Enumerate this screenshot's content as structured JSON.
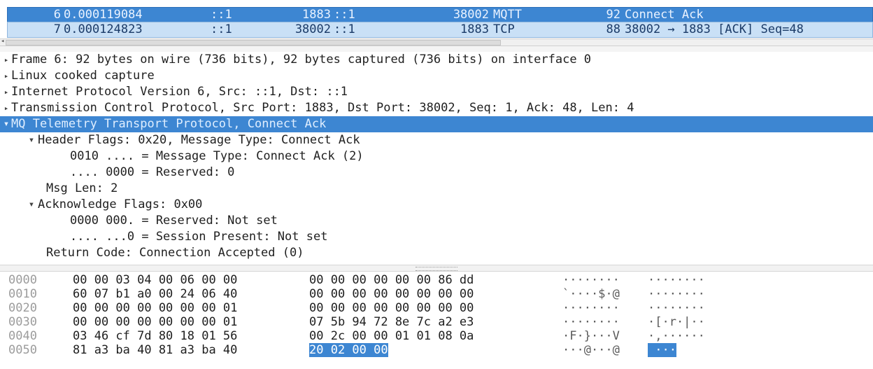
{
  "packet_list": {
    "rows": [
      {
        "no": "6",
        "time": "0.000119084",
        "src": "::1",
        "src_port": "1883",
        "dst": "::1",
        "dst_port": "38002",
        "protocol": "MQTT",
        "length": "92",
        "info": "Connect Ack",
        "selected": true
      },
      {
        "no": "7",
        "time": "0.000124823",
        "src": "::1",
        "src_port": "38002",
        "dst": "::1",
        "dst_port": "1883",
        "protocol": "TCP",
        "length": "88",
        "info": "38002 → 1883 [ACK] Seq=48",
        "selected": false
      }
    ]
  },
  "details": {
    "rows": [
      {
        "text": "Frame 6: 92 bytes on wire (736 bits), 92 bytes captured (736 bits) on interface 0",
        "indent": 0,
        "toggle": "collapsed",
        "selected": false
      },
      {
        "text": "Linux cooked capture",
        "indent": 0,
        "toggle": "collapsed",
        "selected": false
      },
      {
        "text": "Internet Protocol Version 6, Src: ::1, Dst: ::1",
        "indent": 0,
        "toggle": "collapsed",
        "selected": false
      },
      {
        "text": "Transmission Control Protocol, Src Port: 1883, Dst Port: 38002, Seq: 1, Ack: 48, Len: 4",
        "indent": 0,
        "toggle": "collapsed",
        "selected": false
      },
      {
        "text": "MQ Telemetry Transport Protocol, Connect Ack",
        "indent": 0,
        "toggle": "expanded",
        "selected": true
      },
      {
        "text": "Header Flags: 0x20, Message Type: Connect Ack",
        "indent": 1,
        "toggle": "expanded",
        "selected": false
      },
      {
        "text": "0010 .... = Message Type: Connect Ack (2)",
        "indent": 2,
        "toggle": "none",
        "selected": false
      },
      {
        "text": ".... 0000 = Reserved: 0",
        "indent": 2,
        "toggle": "none",
        "selected": false
      },
      {
        "text": "Msg Len: 2",
        "indent": 1,
        "toggle": "none",
        "selected": false
      },
      {
        "text": "Acknowledge Flags: 0x00",
        "indent": 1,
        "toggle": "expanded",
        "selected": false
      },
      {
        "text": "0000 000. = Reserved: Not set",
        "indent": 2,
        "toggle": "none",
        "selected": false
      },
      {
        "text": ".... ...0 = Session Present: Not set",
        "indent": 2,
        "toggle": "none",
        "selected": false
      },
      {
        "text": "Return Code: Connection Accepted (0)",
        "indent": 1,
        "toggle": "none",
        "selected": false
      }
    ]
  },
  "bytes": {
    "rows": [
      {
        "offset": "0000",
        "hex_a": "00 00 03 04 00 06 00 00",
        "hex_b": "00 00 00 00 00 00 86 dd",
        "ascii_a": "········",
        "ascii_b": "········",
        "hl_b": false
      },
      {
        "offset": "0010",
        "hex_a": "60 07 b1 a0 00 24 06 40",
        "hex_b": "00 00 00 00 00 00 00 00",
        "ascii_a": "`····$·@",
        "ascii_b": "········",
        "hl_b": false
      },
      {
        "offset": "0020",
        "hex_a": "00 00 00 00 00 00 00 01",
        "hex_b": "00 00 00 00 00 00 00 00",
        "ascii_a": "········",
        "ascii_b": "········",
        "hl_b": false
      },
      {
        "offset": "0030",
        "hex_a": "00 00 00 00 00 00 00 01",
        "hex_b": "07 5b 94 72 8e 7c a2 e3",
        "ascii_a": "········",
        "ascii_b": "·[·r·|··",
        "hl_b": false
      },
      {
        "offset": "0040",
        "hex_a": "03 46 cf 7d 80 18 01 56",
        "hex_b": "00 2c 00 00 01 01 08 0a",
        "ascii_a": "·F·}···V",
        "ascii_b": "·,······",
        "hl_b": false
      },
      {
        "offset": "0050",
        "hex_a": "81 a3 ba 40 81 a3 ba 40",
        "hex_b": "20 02 00 00",
        "ascii_a": "···@···@",
        "ascii_b": " ···",
        "hl_b": true
      }
    ]
  },
  "colors": {
    "selection": "#3d86d2",
    "packet_row": "#c9e0f6"
  }
}
